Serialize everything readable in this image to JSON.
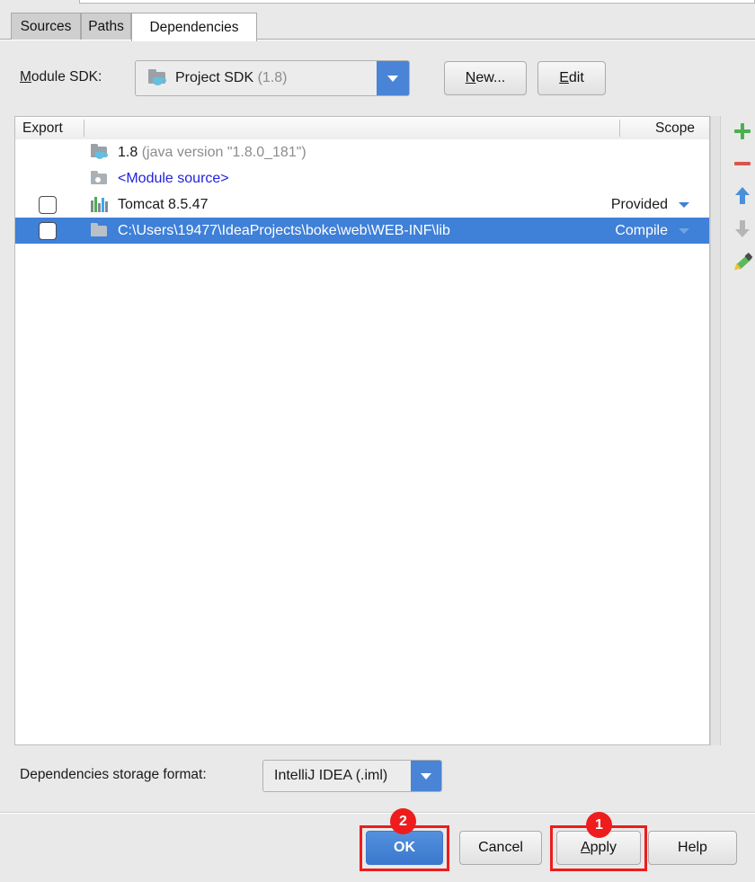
{
  "window": {
    "tabs": [
      {
        "label": "Sources",
        "selected": false
      },
      {
        "label": "Paths",
        "selected": false
      },
      {
        "label": "Dependencies",
        "selected": true
      }
    ]
  },
  "sdk_row": {
    "label_prefix": "M",
    "label_rest": "odule SDK:",
    "combo_icon": "folder-java-icon",
    "combo_value": "Project SDK",
    "combo_value_suffix": "(1.8)",
    "new_button": {
      "mnemonic": "N",
      "rest": "ew..."
    },
    "edit_button": {
      "mnemonic": "E",
      "rest": "dit"
    }
  },
  "table": {
    "columns": {
      "export": "Export",
      "scope": "Scope"
    },
    "rows": [
      {
        "checkbox": null,
        "icon": "folder-java-icon",
        "label": "1.8",
        "label_suffix": "(java version \"1.8.0_181\")",
        "scope": "",
        "selected": false,
        "link": false
      },
      {
        "checkbox": null,
        "icon": "module-source-icon",
        "label": "<Module source>",
        "label_suffix": "",
        "scope": "",
        "selected": false,
        "link": true
      },
      {
        "checkbox": "unchecked",
        "icon": "tomcat-bars-icon",
        "label": "Tomcat 8.5.47",
        "label_suffix": "",
        "scope": "Provided",
        "selected": false,
        "link": false
      },
      {
        "checkbox": "unchecked",
        "icon": "folder-icon",
        "label": "C:\\Users\\19477\\IdeaProjects\\boke\\web\\WEB-INF\\lib",
        "label_suffix": "",
        "scope": "Compile",
        "selected": true,
        "link": false
      }
    ]
  },
  "toolbar": {
    "add": "add-icon",
    "remove": "remove-icon",
    "move_up": "arrow-up-icon",
    "move_down": "arrow-down-icon",
    "edit": "pencil-icon"
  },
  "storage": {
    "label": "Dependencies storage format:",
    "value": "IntelliJ IDEA (.iml)"
  },
  "footer": {
    "ok": "OK",
    "cancel": "Cancel",
    "apply_mnemonic": "A",
    "apply_rest": "pply",
    "help": "Help"
  },
  "annotations": {
    "badge_apply": "1",
    "badge_ok": "2",
    "highlight_color": "#ee1c1c"
  }
}
